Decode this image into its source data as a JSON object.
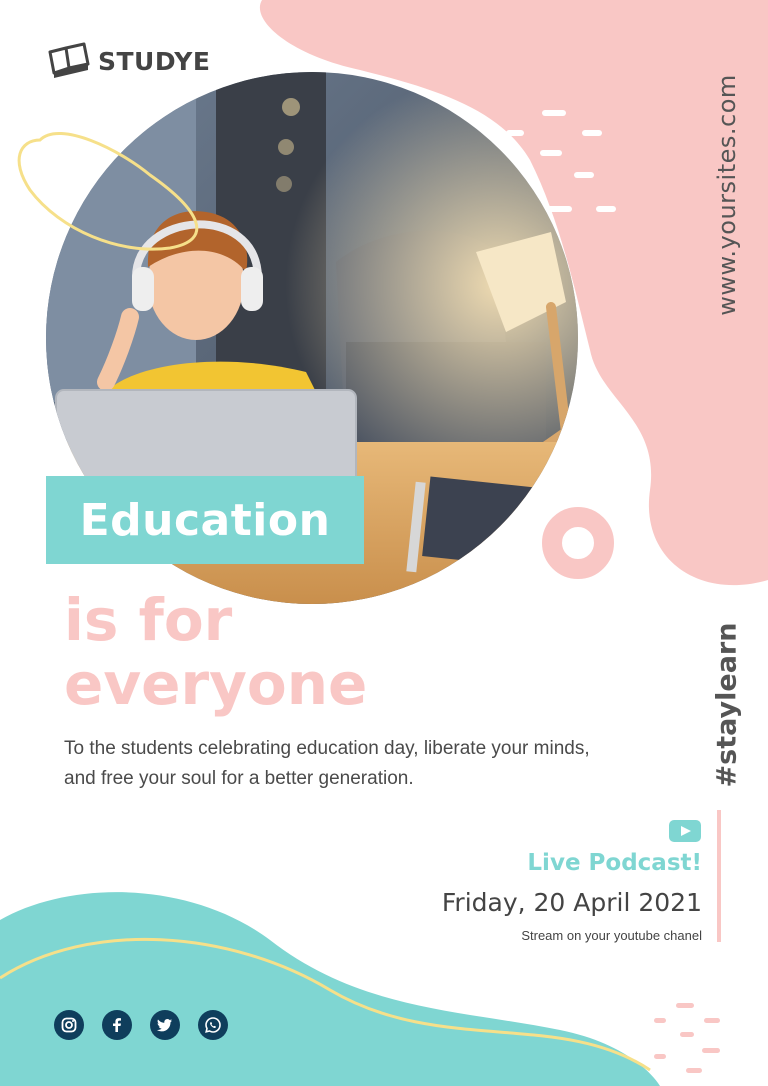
{
  "brand": {
    "name": "STUDYE",
    "icon": "open-book-icon"
  },
  "headline": {
    "highlight": "Education",
    "line2": "is for",
    "line3": "everyone"
  },
  "body": {
    "text": "To the students celebrating education day, liberate your minds, and free your soul for a better generation."
  },
  "side": {
    "website": "www.yoursites.com",
    "hashtag": "#staylearn"
  },
  "event": {
    "icon": "youtube-icon",
    "title": "Live Podcast!",
    "date": "Friday, 20 April 2021",
    "note": "Stream on your youtube chanel"
  },
  "socials": [
    "instagram-icon",
    "facebook-icon",
    "twitter-icon",
    "whatsapp-icon"
  ],
  "colors": {
    "pink": "#f9c7c5",
    "teal": "#7fd6d2",
    "yellow": "#f6e08a",
    "navy": "#0f3e5c",
    "text": "#444444"
  }
}
